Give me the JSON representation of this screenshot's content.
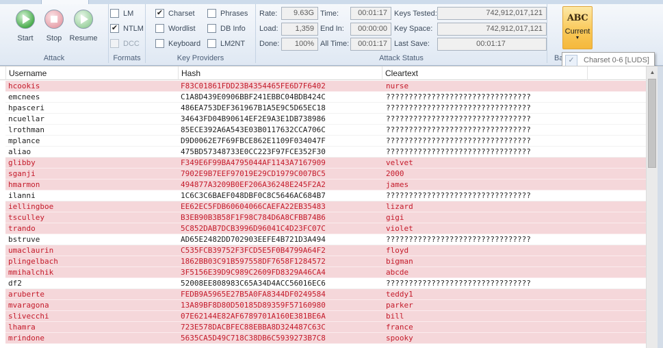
{
  "ribbon": {
    "attack": {
      "group_label": "Attack",
      "start_label": "Start",
      "stop_label": "Stop",
      "resume_label": "Resume"
    },
    "formats": {
      "group_label": "Formats",
      "lm": {
        "label": "LM",
        "checked": false,
        "enabled": true
      },
      "ntlm": {
        "label": "NTLM",
        "checked": true,
        "enabled": true
      },
      "dcc": {
        "label": "DCC",
        "checked": false,
        "enabled": false
      }
    },
    "key_providers": {
      "group_label": "Key Providers",
      "charset": {
        "label": "Charset",
        "checked": true
      },
      "wordlist": {
        "label": "Wordlist",
        "checked": false
      },
      "keyboard": {
        "label": "Keyboard",
        "checked": false
      },
      "phrases": {
        "label": "Phrases",
        "checked": false
      },
      "db_info": {
        "label": "DB Info",
        "checked": false
      },
      "lm2nt": {
        "label": "LM2NT",
        "checked": false
      }
    },
    "attack_status": {
      "group_label": "Attack Status",
      "rate_label": "Rate:",
      "rate_value": "9.63G",
      "load_label": "Load:",
      "load_value": "1,359",
      "done_label": "Done:",
      "done_value": "100%",
      "time_label": "Time:",
      "time_value": "00:01:17",
      "end_in_label": "End In:",
      "end_in_value": "00:00:00",
      "all_time_label": "All Time:",
      "all_time_value": "00:01:17",
      "keys_tested_label": "Keys Tested:",
      "keys_tested_value": "742,912,017,121",
      "key_space_label": "Key Space:",
      "key_space_value": "742,912,017,121",
      "last_save_label": "Last Save:",
      "last_save_value": "00:01:17"
    },
    "current": {
      "icon_text": "ABC",
      "label": "Current",
      "group_label_fragment": "Ba",
      "dropdown_item": "Charset 0-6 [LUDS]",
      "accent_color": "#f9c95a"
    }
  },
  "grid": {
    "columns": [
      "Username",
      "Hash",
      "Cleartext"
    ],
    "cracked_color": "#c41a2a",
    "cracked_bg": "#f5d7da",
    "rows": [
      {
        "user": "hcookis",
        "hash": "F83C01861FDD23B4354465FE6D7F6402",
        "clear": "nurse",
        "cracked": true
      },
      {
        "user": "emcnees",
        "hash": "C1A8D439E0906BBF241EBBC04BDB424C",
        "clear": "????????????????????????????????",
        "cracked": false
      },
      {
        "user": "hpasceri",
        "hash": "486EA753DEF361967B1A5E9C5D65EC18",
        "clear": "????????????????????????????????",
        "cracked": false
      },
      {
        "user": "ncuellar",
        "hash": "34643FD04B90614EF2E9A3E1DB738986",
        "clear": "????????????????????????????????",
        "cracked": false
      },
      {
        "user": "lrothman",
        "hash": "85ECE392A6A543E03B0117632CCA706C",
        "clear": "????????????????????????????????",
        "cracked": false
      },
      {
        "user": "mplance",
        "hash": "D9D0062E7F69FBCE862E1109F034047F",
        "clear": "????????????????????????????????",
        "cracked": false
      },
      {
        "user": "aliao",
        "hash": "475BD57348733E0CC223F97FCE352F30",
        "clear": "????????????????????????????????",
        "cracked": false
      },
      {
        "user": "glibby",
        "hash": "F349E6F99BA4795044AF1143A7167909",
        "clear": "velvet",
        "cracked": true
      },
      {
        "user": "sganji",
        "hash": "7902E9B7EEF97019E29CD1979C007BC5",
        "clear": "2000",
        "cracked": true
      },
      {
        "user": "hmarmon",
        "hash": "494877A3209B0EF206A36248E245F2A2",
        "clear": "james",
        "cracked": true
      },
      {
        "user": "ilanni",
        "hash": "1C6C3C6BAEF048DBF0C8C5646AC684B7",
        "clear": "????????????????????????????????",
        "cracked": false
      },
      {
        "user": "iellingboe",
        "hash": "EE62EC5FDB60604066CAEFA22EB35483",
        "clear": "lizard",
        "cracked": true
      },
      {
        "user": "tsculley",
        "hash": "B3EB90B3B58F1F98C784D6A8CFBB74B6",
        "clear": "gigi",
        "cracked": true
      },
      {
        "user": "trando",
        "hash": "5C852DAB7DCB3996D96041C4D23FC07C",
        "clear": "violet",
        "cracked": true
      },
      {
        "user": "bstruve",
        "hash": "AD65E2482DD702903EEFE4B721D3A494",
        "clear": "????????????????????????????????",
        "cracked": false
      },
      {
        "user": "umaclaurin",
        "hash": "C535FCB39752F3FCD5E5F0B4799A64F2",
        "clear": "floyd",
        "cracked": true
      },
      {
        "user": "plingelbach",
        "hash": "1862BB03C91B597558DF7658F1284572",
        "clear": "bigman",
        "cracked": true
      },
      {
        "user": "mmihalchik",
        "hash": "3F5156E39D9C989C2609FD8329A46CA4",
        "clear": "abcde",
        "cracked": true
      },
      {
        "user": "df2",
        "hash": "52008EE808983C65A34D4ACC56016EC6",
        "clear": "????????????????????????????????",
        "cracked": false
      },
      {
        "user": "aruberte",
        "hash": "FEDB9A5965E27B5A0FA8344DF0249584",
        "clear": "teddy1",
        "cracked": true
      },
      {
        "user": "mvaragona",
        "hash": "13A89BF8D80D50185D89359F57160980",
        "clear": "parker",
        "cracked": true
      },
      {
        "user": "slivecchi",
        "hash": "07E62144E82AF6789701A160E381BE6A",
        "clear": "bill",
        "cracked": true
      },
      {
        "user": "lhamra",
        "hash": "723E578DACBFEC88EBBA8D324487C63C",
        "clear": "france",
        "cracked": true
      },
      {
        "user": "mrindone",
        "hash": "5635CA5D49C718C38DB6C5939273B7C8",
        "clear": "spooky",
        "cracked": true
      }
    ]
  }
}
